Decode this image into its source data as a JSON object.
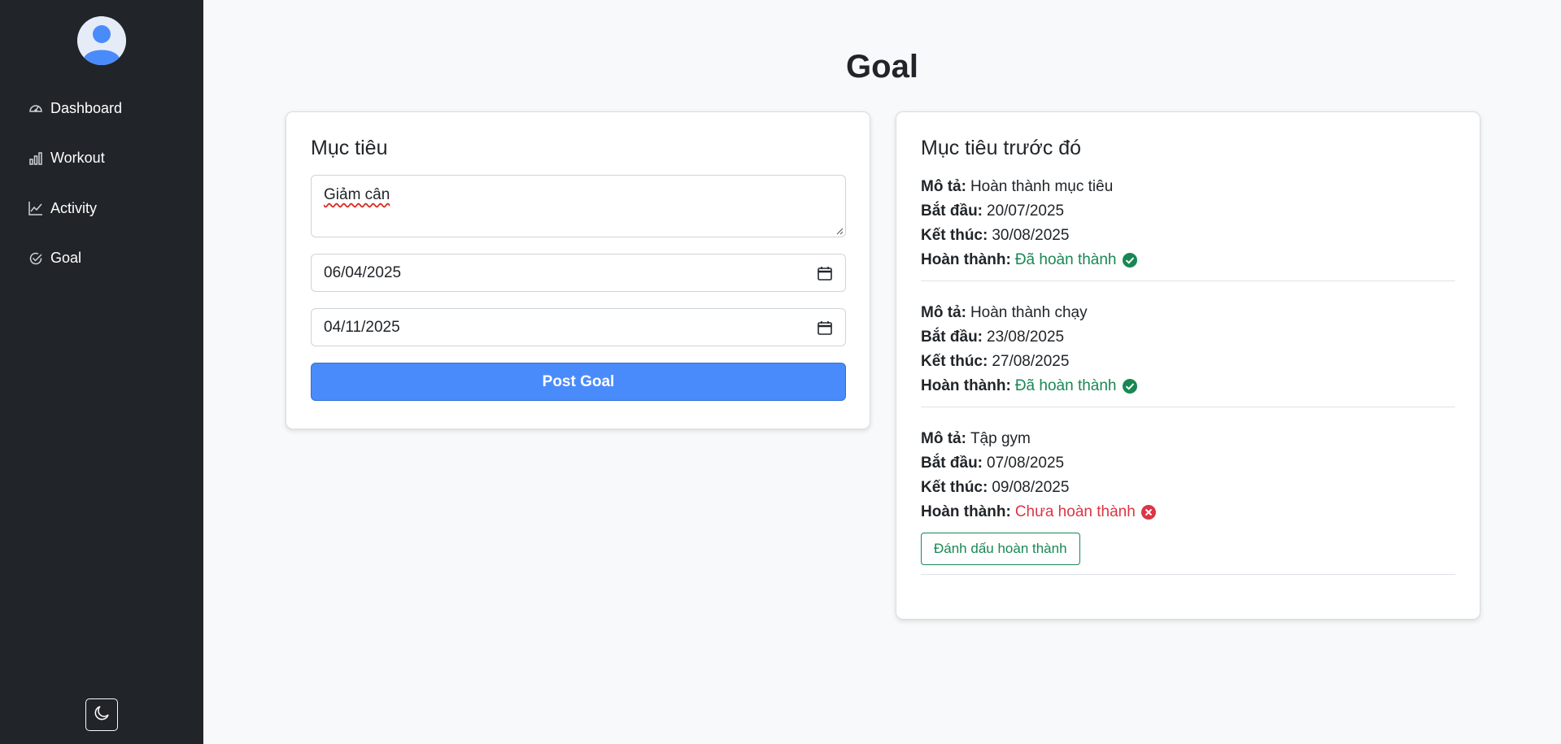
{
  "sidebar": {
    "avatar_icon": "user-avatar-icon",
    "items": [
      {
        "label": "Dashboard",
        "icon": "speedometer-icon"
      },
      {
        "label": "Workout",
        "icon": "bar-chart-icon"
      },
      {
        "label": "Activity",
        "icon": "line-chart-icon"
      },
      {
        "label": "Goal",
        "icon": "check-circle-icon"
      }
    ],
    "theme_toggle_icon": "moon-icon"
  },
  "page": {
    "title": "Goal"
  },
  "form": {
    "title": "Mục tiêu",
    "description_value": "Giảm cân",
    "start_date": "06/04/2025",
    "end_date": "04/11/2025",
    "submit_label": "Post Goal"
  },
  "previous": {
    "title": "Mục tiêu trước đó",
    "labels": {
      "description": "Mô tả:",
      "start": "Bắt đầu:",
      "end": "Kết thúc:",
      "done": "Hoàn thành:"
    },
    "goals": [
      {
        "description": "Hoàn thành mục tiêu",
        "start": "20/07/2025",
        "end": "30/08/2025",
        "status": "Đã hoàn thành"
      },
      {
        "description": "Hoàn thành chạy",
        "start": "23/08/2025",
        "end": "27/08/2025",
        "status": "Đã hoàn thành"
      },
      {
        "description": "Tập gym",
        "start": "07/08/2025",
        "end": "09/08/2025",
        "status": "Chưa hoàn thành",
        "action_label": "Đánh dấu hoàn thành"
      }
    ]
  },
  "colors": {
    "sidebar_bg": "#212529",
    "primary": "#4a8bfc",
    "success": "#198754",
    "danger": "#dc3545",
    "page_bg": "#f8f9fa"
  }
}
